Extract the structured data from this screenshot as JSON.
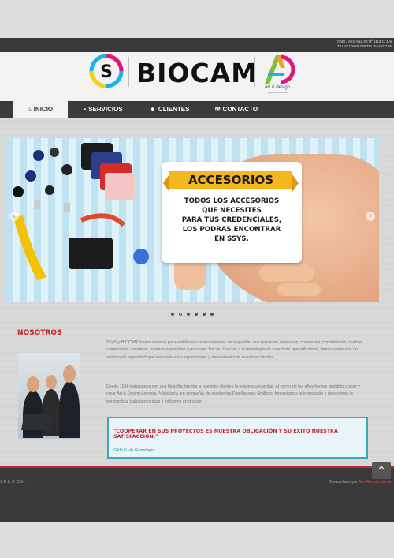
{
  "topbar": {
    "contact_line1": "CMG. MEGANA 00 Nº 1113 C/ SAN RAFAEL",
    "contact_line2": "TEL:0210688-238 TEL:FAX 0219655-1"
  },
  "brand": {
    "name": "BIOCAM",
    "partner_name": "art & design",
    "partner_sub": "agencia publicitaria"
  },
  "nav": {
    "items": [
      {
        "label": "INICIO",
        "icon": "home-icon"
      },
      {
        "label": "SERVICIOS",
        "icon": "briefcase-icon"
      },
      {
        "label": "CLIENTES",
        "icon": "users-icon"
      },
      {
        "label": "CONTACTO",
        "icon": "envelope-icon"
      }
    ]
  },
  "banner": {
    "heading": "ACCESORIOS",
    "lines": [
      "TODOS LOS ACCESORIOS",
      "QUE NECESITES",
      "PARA TUS CREDENCIALES,",
      "LOS PODRAS ENCONTRAR",
      "EN SSYS."
    ]
  },
  "slider": {
    "dot_count": 6,
    "active_index": 1
  },
  "about": {
    "title": "NOSOTROS",
    "p1": "SSyS y BIOCAM fueron creadas para satisfacer las necesidades de seguridad que requieren empresas, consorcios, condominios, centros comerciales, countries, eventos especiales y personas físicas. Gracias a la tecnología de avanzada que utilizamos, hemos generado un sistema de seguridad que responde a las expectativas y necesidades de nuestros clientes.",
    "p2": "Desde 1996 trabajamos con una filosofía: brindar a nuestros clientes la máxima seguridad. Al correr de los años hemos decidido crecer y crear Art & Desing Agencia Publicitaria, en compañía de excelentes Diseñadores Gráficos, fomentamos la innovación y devoramos la perspectiva, trabajamos duro y soñamos en grande.",
    "quote": "\"COOPERAR EN SUS PROYECTOS ES NUESTRA OBLIGACIÓN Y SU ÉXITO NUESTRA SATISFACCIÓN.\"",
    "author": "Gildo G. de Garastiago"
  },
  "footer": {
    "copyright": "S.R.L. © 2014",
    "dev_prefix": "Desarrollado por",
    "dev_link": "Alto Resolución.net"
  },
  "colors": {
    "accent_red": "#c0272d",
    "teal": "#35aab8",
    "dark": "#3a3a3a",
    "ribbon": "#f3b71c"
  }
}
